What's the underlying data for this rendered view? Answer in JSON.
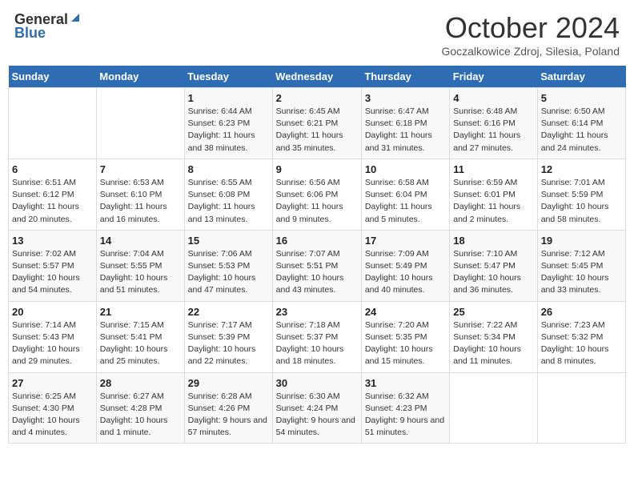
{
  "header": {
    "logo_general": "General",
    "logo_blue": "Blue",
    "month": "October 2024",
    "location": "Goczalkowice Zdroj, Silesia, Poland"
  },
  "weekdays": [
    "Sunday",
    "Monday",
    "Tuesday",
    "Wednesday",
    "Thursday",
    "Friday",
    "Saturday"
  ],
  "weeks": [
    [
      {
        "day": "",
        "info": ""
      },
      {
        "day": "",
        "info": ""
      },
      {
        "day": "1",
        "info": "Sunrise: 6:44 AM\nSunset: 6:23 PM\nDaylight: 11 hours and 38 minutes."
      },
      {
        "day": "2",
        "info": "Sunrise: 6:45 AM\nSunset: 6:21 PM\nDaylight: 11 hours and 35 minutes."
      },
      {
        "day": "3",
        "info": "Sunrise: 6:47 AM\nSunset: 6:18 PM\nDaylight: 11 hours and 31 minutes."
      },
      {
        "day": "4",
        "info": "Sunrise: 6:48 AM\nSunset: 6:16 PM\nDaylight: 11 hours and 27 minutes."
      },
      {
        "day": "5",
        "info": "Sunrise: 6:50 AM\nSunset: 6:14 PM\nDaylight: 11 hours and 24 minutes."
      }
    ],
    [
      {
        "day": "6",
        "info": "Sunrise: 6:51 AM\nSunset: 6:12 PM\nDaylight: 11 hours and 20 minutes."
      },
      {
        "day": "7",
        "info": "Sunrise: 6:53 AM\nSunset: 6:10 PM\nDaylight: 11 hours and 16 minutes."
      },
      {
        "day": "8",
        "info": "Sunrise: 6:55 AM\nSunset: 6:08 PM\nDaylight: 11 hours and 13 minutes."
      },
      {
        "day": "9",
        "info": "Sunrise: 6:56 AM\nSunset: 6:06 PM\nDaylight: 11 hours and 9 minutes."
      },
      {
        "day": "10",
        "info": "Sunrise: 6:58 AM\nSunset: 6:04 PM\nDaylight: 11 hours and 5 minutes."
      },
      {
        "day": "11",
        "info": "Sunrise: 6:59 AM\nSunset: 6:01 PM\nDaylight: 11 hours and 2 minutes."
      },
      {
        "day": "12",
        "info": "Sunrise: 7:01 AM\nSunset: 5:59 PM\nDaylight: 10 hours and 58 minutes."
      }
    ],
    [
      {
        "day": "13",
        "info": "Sunrise: 7:02 AM\nSunset: 5:57 PM\nDaylight: 10 hours and 54 minutes."
      },
      {
        "day": "14",
        "info": "Sunrise: 7:04 AM\nSunset: 5:55 PM\nDaylight: 10 hours and 51 minutes."
      },
      {
        "day": "15",
        "info": "Sunrise: 7:06 AM\nSunset: 5:53 PM\nDaylight: 10 hours and 47 minutes."
      },
      {
        "day": "16",
        "info": "Sunrise: 7:07 AM\nSunset: 5:51 PM\nDaylight: 10 hours and 43 minutes."
      },
      {
        "day": "17",
        "info": "Sunrise: 7:09 AM\nSunset: 5:49 PM\nDaylight: 10 hours and 40 minutes."
      },
      {
        "day": "18",
        "info": "Sunrise: 7:10 AM\nSunset: 5:47 PM\nDaylight: 10 hours and 36 minutes."
      },
      {
        "day": "19",
        "info": "Sunrise: 7:12 AM\nSunset: 5:45 PM\nDaylight: 10 hours and 33 minutes."
      }
    ],
    [
      {
        "day": "20",
        "info": "Sunrise: 7:14 AM\nSunset: 5:43 PM\nDaylight: 10 hours and 29 minutes."
      },
      {
        "day": "21",
        "info": "Sunrise: 7:15 AM\nSunset: 5:41 PM\nDaylight: 10 hours and 25 minutes."
      },
      {
        "day": "22",
        "info": "Sunrise: 7:17 AM\nSunset: 5:39 PM\nDaylight: 10 hours and 22 minutes."
      },
      {
        "day": "23",
        "info": "Sunrise: 7:18 AM\nSunset: 5:37 PM\nDaylight: 10 hours and 18 minutes."
      },
      {
        "day": "24",
        "info": "Sunrise: 7:20 AM\nSunset: 5:35 PM\nDaylight: 10 hours and 15 minutes."
      },
      {
        "day": "25",
        "info": "Sunrise: 7:22 AM\nSunset: 5:34 PM\nDaylight: 10 hours and 11 minutes."
      },
      {
        "day": "26",
        "info": "Sunrise: 7:23 AM\nSunset: 5:32 PM\nDaylight: 10 hours and 8 minutes."
      }
    ],
    [
      {
        "day": "27",
        "info": "Sunrise: 6:25 AM\nSunset: 4:30 PM\nDaylight: 10 hours and 4 minutes."
      },
      {
        "day": "28",
        "info": "Sunrise: 6:27 AM\nSunset: 4:28 PM\nDaylight: 10 hours and 1 minute."
      },
      {
        "day": "29",
        "info": "Sunrise: 6:28 AM\nSunset: 4:26 PM\nDaylight: 9 hours and 57 minutes."
      },
      {
        "day": "30",
        "info": "Sunrise: 6:30 AM\nSunset: 4:24 PM\nDaylight: 9 hours and 54 minutes."
      },
      {
        "day": "31",
        "info": "Sunrise: 6:32 AM\nSunset: 4:23 PM\nDaylight: 9 hours and 51 minutes."
      },
      {
        "day": "",
        "info": ""
      },
      {
        "day": "",
        "info": ""
      }
    ]
  ]
}
